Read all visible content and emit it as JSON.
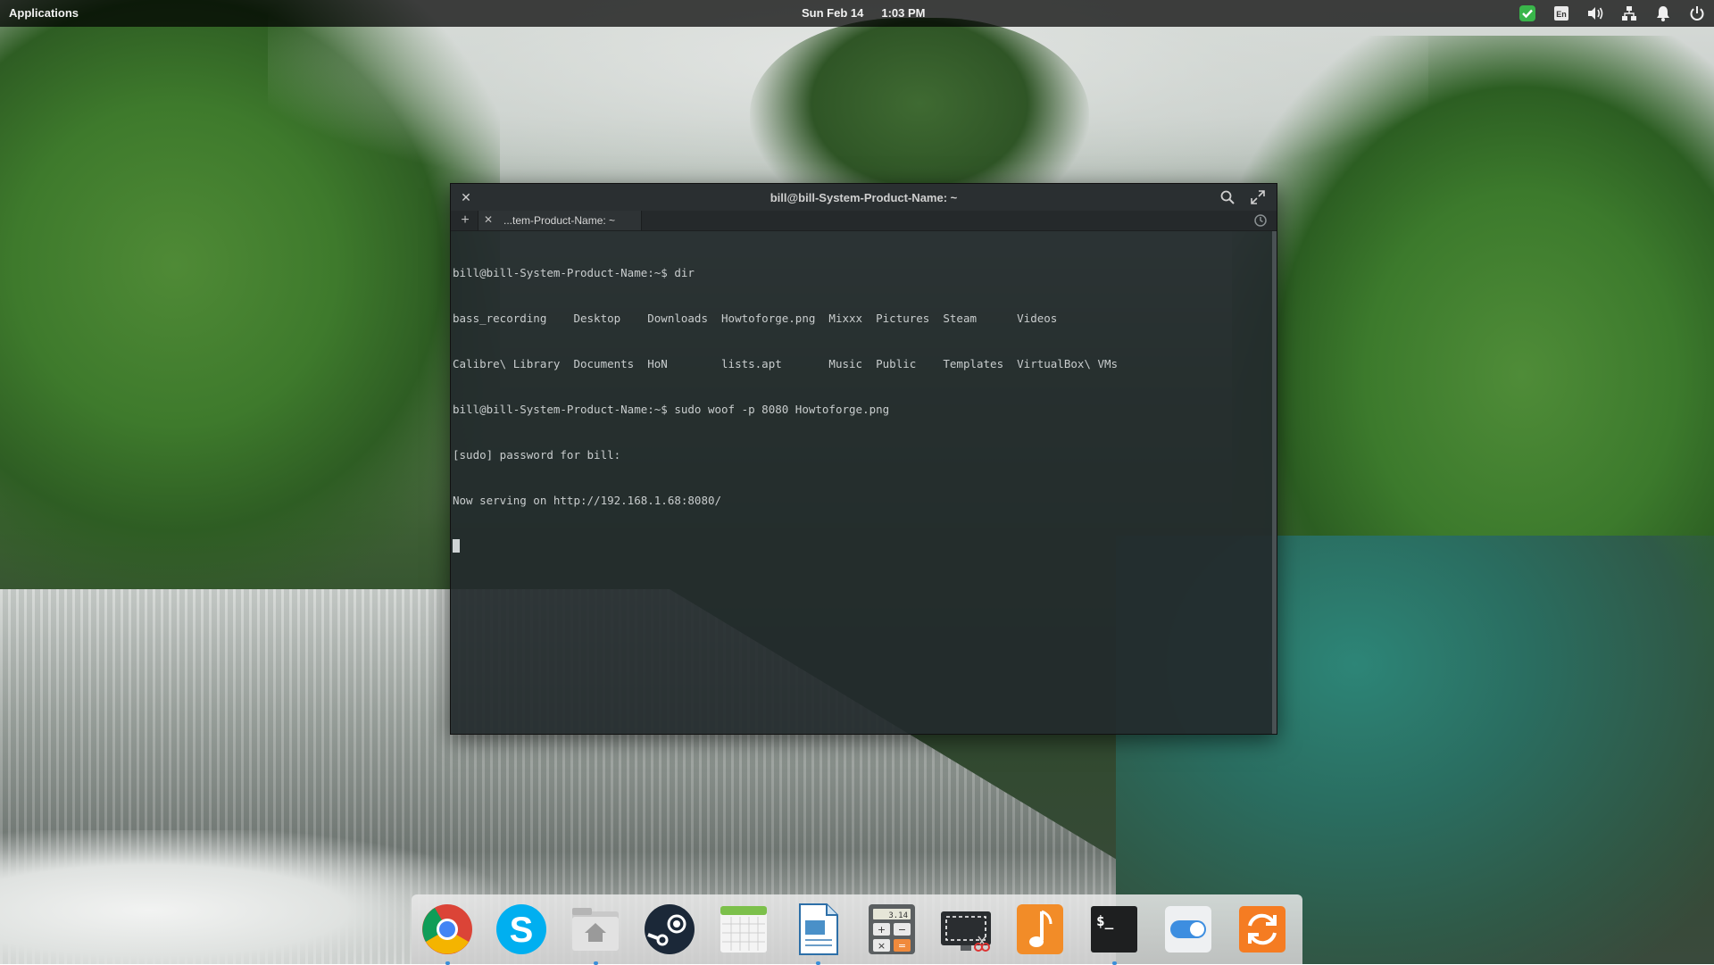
{
  "top_panel": {
    "applications_label": "Applications",
    "date": "Sun Feb 14",
    "time": "1:03 PM",
    "indicators": [
      {
        "name": "security-check-icon",
        "color": "#39b54a"
      },
      {
        "name": "keyboard-layout-icon",
        "label": "En"
      },
      {
        "name": "volume-icon"
      },
      {
        "name": "network-icon"
      },
      {
        "name": "notifications-icon"
      },
      {
        "name": "power-icon"
      }
    ]
  },
  "terminal": {
    "window_title": "bill@bill-System-Product-Name: ~",
    "tab_label": "...tem-Product-Name: ~",
    "lines": [
      "bill@bill-System-Product-Name:~$ dir",
      "bass_recording    Desktop    Downloads  Howtoforge.png  Mixxx  Pictures  Steam      Videos",
      "Calibre\\ Library  Documents  HoN        lists.apt       Music  Public    Templates  VirtualBox\\ VMs",
      "bill@bill-System-Product-Name:~$ sudo woof -p 8080 Howtoforge.png",
      "[sudo] password for bill:",
      "Now serving on http://192.168.1.68:8080/"
    ],
    "background": "#222a2c"
  },
  "dock": {
    "items": [
      {
        "name": "chrome",
        "running": true
      },
      {
        "name": "skype",
        "running": false
      },
      {
        "name": "files",
        "running": true
      },
      {
        "name": "steam",
        "running": false
      },
      {
        "name": "calendar",
        "running": false
      },
      {
        "name": "document-viewer",
        "running": true
      },
      {
        "name": "calculator",
        "running": false
      },
      {
        "name": "screenshot",
        "running": false
      },
      {
        "name": "music",
        "running": false
      },
      {
        "name": "terminal",
        "running": true
      },
      {
        "name": "settings",
        "running": false
      },
      {
        "name": "updates",
        "running": false
      }
    ],
    "calculator_display": "3.14",
    "terminal_prompt_glyph": "$_"
  }
}
